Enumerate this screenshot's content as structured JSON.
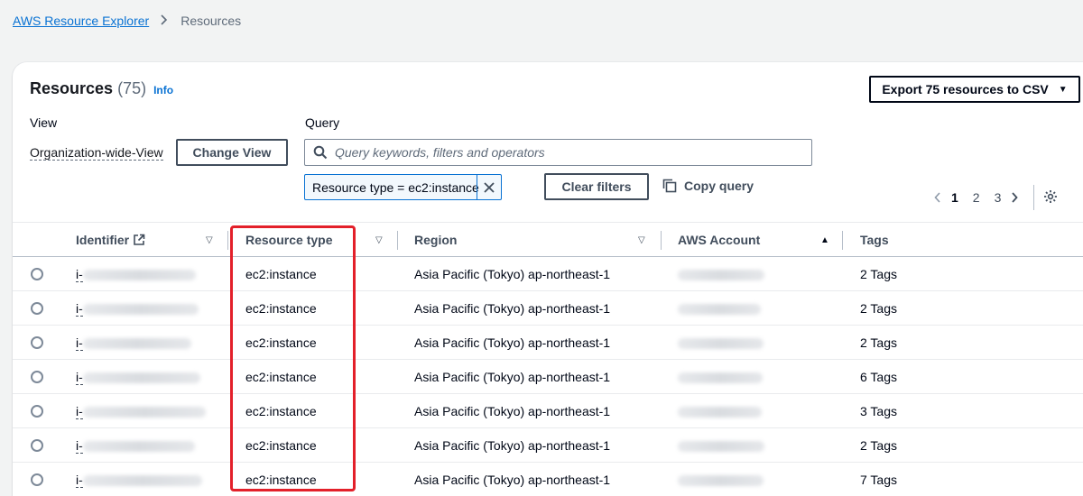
{
  "breadcrumb": {
    "root": "AWS Resource Explorer",
    "current": "Resources"
  },
  "header": {
    "title": "Resources",
    "count": "(75)",
    "info": "Info",
    "export_label": "Export 75 resources to CSV"
  },
  "view": {
    "label": "View",
    "value": "Organization-wide-View",
    "change_label": "Change View"
  },
  "query": {
    "label": "Query",
    "placeholder": "Query keywords, filters and operators",
    "token": "Resource type = ec2:instance",
    "clear_label": "Clear filters",
    "copy_label": "Copy query"
  },
  "pagination": {
    "pages": [
      "1",
      "2",
      "3"
    ],
    "current": "1"
  },
  "table": {
    "columns": [
      "Identifier",
      "Resource type",
      "Region",
      "AWS Account",
      "Tags"
    ],
    "rows": [
      {
        "identifier": "i-",
        "type": "ec2:instance",
        "region": "Asia Pacific (Tokyo) ap-northeast-1",
        "tags": "2 Tags"
      },
      {
        "identifier": "i-",
        "type": "ec2:instance",
        "region": "Asia Pacific (Tokyo) ap-northeast-1",
        "tags": "2 Tags"
      },
      {
        "identifier": "i-",
        "type": "ec2:instance",
        "region": "Asia Pacific (Tokyo) ap-northeast-1",
        "tags": "2 Tags"
      },
      {
        "identifier": "i-",
        "type": "ec2:instance",
        "region": "Asia Pacific (Tokyo) ap-northeast-1",
        "tags": "6 Tags"
      },
      {
        "identifier": "i-",
        "type": "ec2:instance",
        "region": "Asia Pacific (Tokyo) ap-northeast-1",
        "tags": "3 Tags"
      },
      {
        "identifier": "i-",
        "type": "ec2:instance",
        "region": "Asia Pacific (Tokyo) ap-northeast-1",
        "tags": "2 Tags"
      },
      {
        "identifier": "i-",
        "type": "ec2:instance",
        "region": "Asia Pacific (Tokyo) ap-northeast-1",
        "tags": "7 Tags"
      }
    ]
  },
  "colors": {
    "link": "#0972d3",
    "highlight": "#e3202a",
    "text": "#000716"
  }
}
